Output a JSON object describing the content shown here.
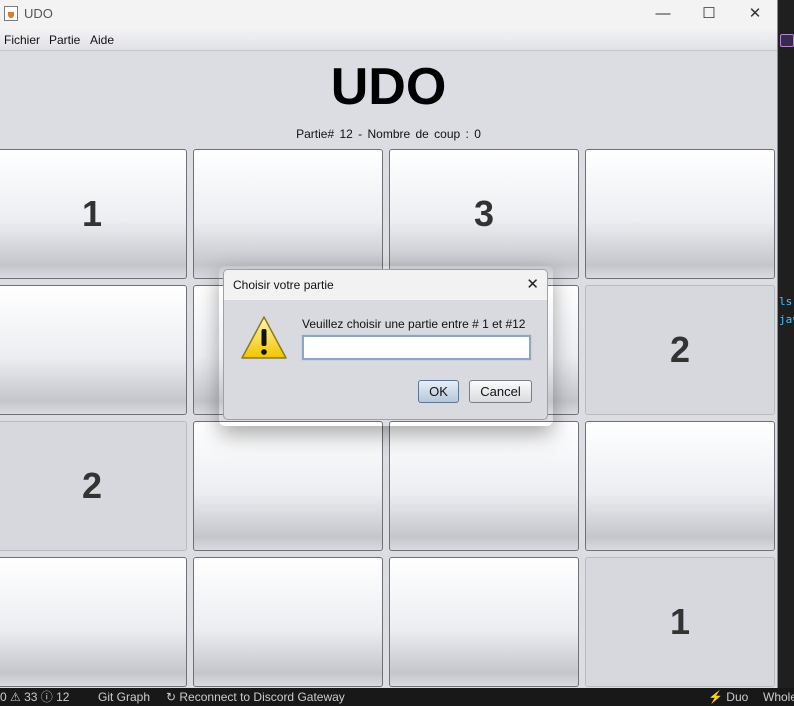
{
  "window": {
    "title": "UDO",
    "controls": {
      "minimize": "—",
      "maximize": "☐",
      "close": "✕"
    }
  },
  "menu": [
    "Fichier",
    "Partie",
    "Aide"
  ],
  "game": {
    "title": "UDO",
    "info": "Partie#  12 -  Nombre de coup :  0",
    "grid": [
      [
        "1",
        "",
        "3",
        ""
      ],
      [
        "",
        "",
        "",
        "2"
      ],
      [
        "2",
        "",
        "",
        ""
      ],
      [
        "",
        "",
        "",
        "1"
      ]
    ]
  },
  "dialog": {
    "title": "Choisir votre partie",
    "close": "✕",
    "message": "Veuillez choisir une partie entre # 1 et #12",
    "input_value": "",
    "ok_label": "OK",
    "cancel_label": "Cancel",
    "icon": "warning-icon"
  },
  "background": {
    "editor_fragments": [
      "ls",
      "jav"
    ],
    "statusbar": {
      "problems": "0 ⚠ 33 ⓘ 12",
      "git_graph": "Git Graph",
      "discord": "↻ Reconnect to Discord Gateway",
      "duo": "Duo",
      "whole": "Whole"
    }
  }
}
